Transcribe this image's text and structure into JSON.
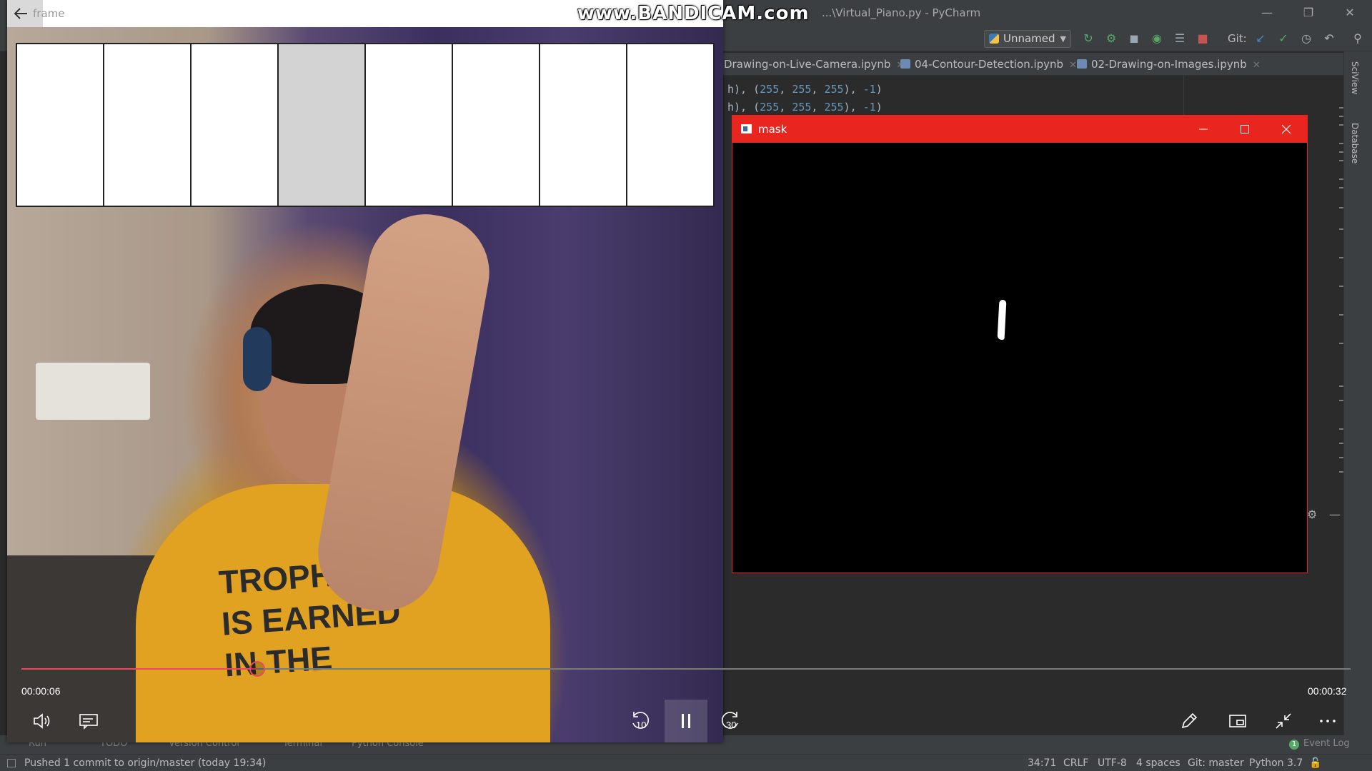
{
  "watermark": "www.BANDICAM.com",
  "ide": {
    "title": "...\\Virtual_Piano.py - PyCharm",
    "run_config": "Unnamed",
    "git_label": "Git:",
    "tabs": [
      {
        "label": "Drawing-on-Live-Camera.ipynb"
      },
      {
        "label": "04-Contour-Detection.ipynb"
      },
      {
        "label": "02-Drawing-on-Images.ipynb"
      }
    ],
    "code_lines": [
      {
        "prefix": "h), (",
        "a": "255",
        "b": "255",
        "c": "255",
        "d": "-1"
      },
      {
        "prefix": "h), (",
        "a": "255",
        "b": "255",
        "c": "255",
        "d": "-1"
      }
    ],
    "side_tabs": [
      "SciView",
      "Database"
    ],
    "tool_windows": [
      "Run",
      "TODO",
      "Version Control",
      "Terminal",
      "Python Console"
    ],
    "event_log": "Event Log",
    "event_count": "1",
    "status": {
      "message": "Pushed 1 commit to origin/master (today 19:34)",
      "position": "34:71",
      "line_sep": "CRLF",
      "encoding": "UTF-8",
      "indent": "4 spaces",
      "branch": "Git: master",
      "interpreter": "Python 3.7"
    }
  },
  "frame_window": {
    "title": "frame",
    "piano_keys": [
      {
        "pressed": false
      },
      {
        "pressed": false
      },
      {
        "pressed": false
      },
      {
        "pressed": true
      },
      {
        "pressed": false
      },
      {
        "pressed": false
      },
      {
        "pressed": false
      },
      {
        "pressed": false
      }
    ],
    "shirt_text": [
      "TROPHY",
      "IS EARNED",
      "IN THE"
    ]
  },
  "mask_window": {
    "title": "mask"
  },
  "player": {
    "current_time": "00:00:06",
    "total_time": "00:00:32",
    "progress_fraction": 0.1773,
    "skip_back": "10",
    "skip_forward": "30",
    "accent": "#e84a5f"
  }
}
